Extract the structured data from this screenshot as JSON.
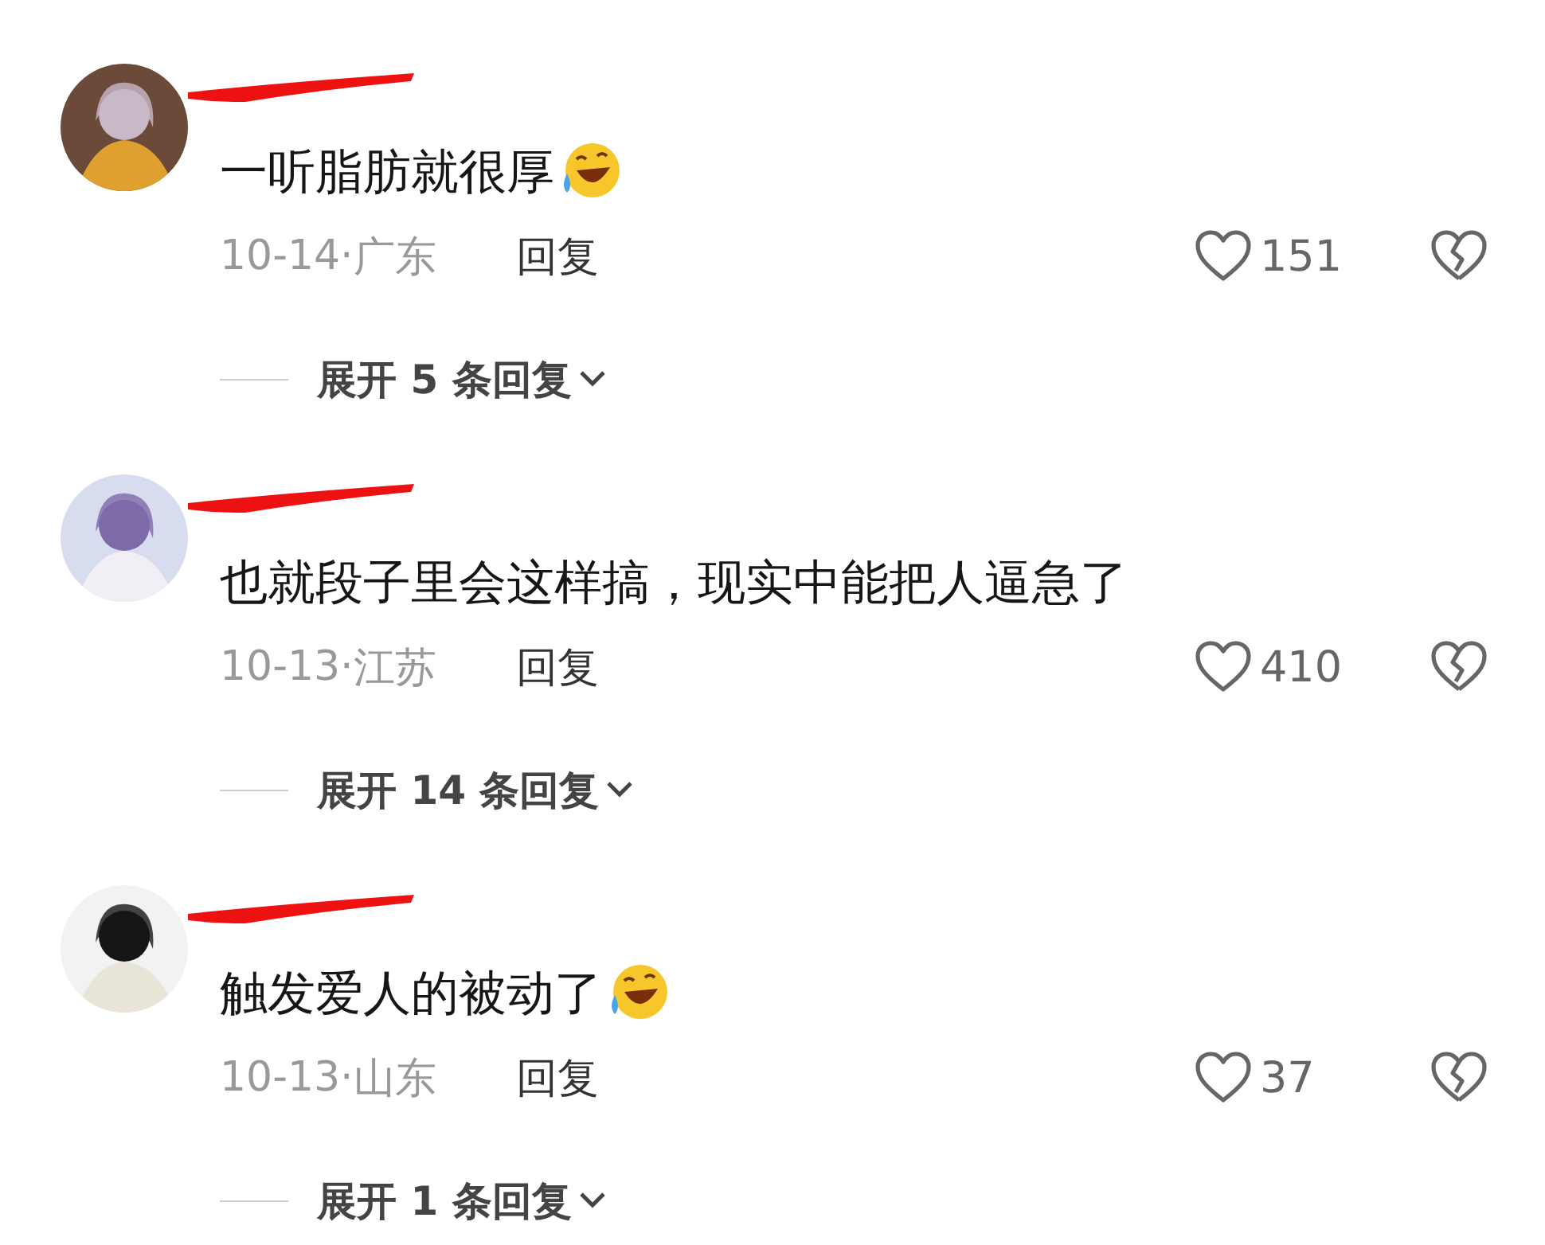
{
  "comments": [
    {
      "name_redacted": true,
      "text": "一听脂肪就很厚",
      "emoji": true,
      "date": "10-14·",
      "location": "广东",
      "reply": "回复",
      "likes": "151",
      "expand": "展开 5 条回复"
    },
    {
      "name_redacted": true,
      "text": "也就段子里会这样搞，现实中能把人逼急了",
      "emoji": false,
      "date": "10-13·",
      "location": "江苏",
      "reply": "回复",
      "likes": "410",
      "expand": "展开 14 条回复"
    },
    {
      "name_redacted": true,
      "text": "触发爱人的被动了",
      "emoji": true,
      "date": "10-13·",
      "location": "山东",
      "reply": "回复",
      "likes": "37",
      "expand": "展开 1 条回复"
    }
  ]
}
